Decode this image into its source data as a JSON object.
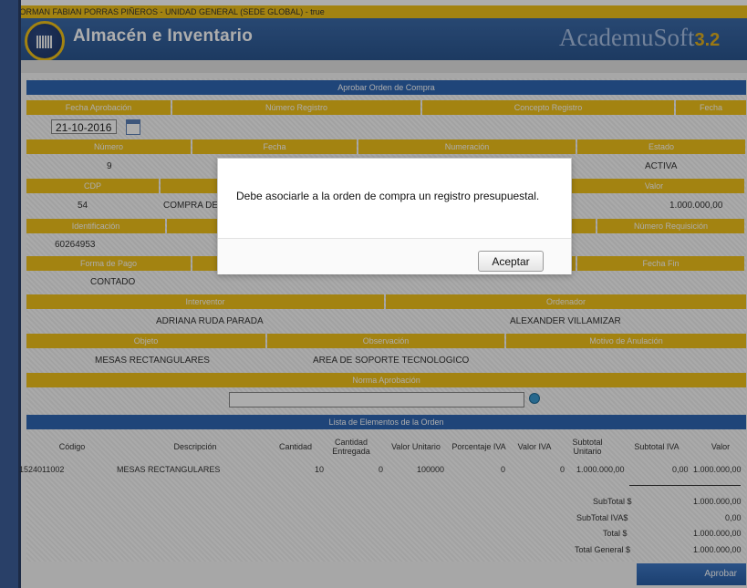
{
  "user_bar": "JORMAN FABIAN PORRAS PIÑEROS - UNIDAD GENERAL (SEDE GLOBAL) - true",
  "app_title": "Almacén e Inventario",
  "brand": {
    "name": "AcademuSoft",
    "version": "3.2"
  },
  "form_title": "Aprobar Orden de Compra",
  "row1": {
    "headers": [
      "Fecha Aprobación",
      "Número Registro",
      "Concepto Registro",
      "Fecha"
    ],
    "date_value": "21-10-2016"
  },
  "row2": {
    "headers": [
      "Número",
      "Fecha",
      "Numeración",
      "Estado"
    ],
    "values": {
      "numero": "9",
      "estado": "ACTIVA"
    }
  },
  "row3": {
    "headers": [
      "CDP",
      "",
      "Valor"
    ],
    "values": {
      "cdp": "54",
      "concepto": "COMPRA DE",
      "valor": "1.000.000,00"
    }
  },
  "row4": {
    "headers": [
      "Identificación",
      "",
      "Número Requisición"
    ],
    "values": {
      "identificacion": "60264953"
    }
  },
  "row5": {
    "headers": [
      "Forma de Pago",
      "",
      "Fecha Fin"
    ],
    "values": {
      "forma_pago": "CONTADO"
    }
  },
  "row6": {
    "headers": [
      "Interventor",
      "Ordenador"
    ],
    "values": {
      "interventor": "ADRIANA RUDA PARADA",
      "ordenador": "ALEXANDER VILLAMIZAR"
    }
  },
  "row7": {
    "headers": [
      "Objeto",
      "Observación",
      "Motivo de Anulación"
    ],
    "values": {
      "objeto": "MESAS RECTANGULARES",
      "observacion": "AREA DE SOPORTE TECNOLOGICO"
    }
  },
  "norma": {
    "header": "Norma Aprobación",
    "value": ""
  },
  "items": {
    "title": "Lista de Elementos de la Orden",
    "columns": [
      "Código",
      "Descripción",
      "Cantidad",
      "Cantidad Entregada",
      "Valor Unitario",
      "Porcentaje IVA",
      "Valor IVA",
      "Subtotal Unitario",
      "Subtotal IVA",
      "Valor"
    ],
    "rows": [
      {
        "codigo": "1524011002",
        "descripcion": "MESAS RECTANGULARES",
        "cantidad": "10",
        "entregada": "0",
        "valor_unitario": "100000",
        "porcentaje_iva": "0",
        "valor_iva": "0",
        "subtotal_unitario": "1.000.000,00",
        "subtotal_iva": "0,00",
        "valor": "1.000.000,00"
      }
    ]
  },
  "totals": [
    {
      "label": "SubTotal $",
      "value": "1.000.000,00"
    },
    {
      "label": "SubTotal IVA$",
      "value": "0,00"
    },
    {
      "label": "Total $",
      "value": "1.000.000,00"
    },
    {
      "label": "Total General $",
      "value": "1.000.000,00"
    }
  ],
  "approve_button": "Aprobar",
  "dialog": {
    "message": "Debe asociarle a la orden de compra un registro presupuestal.",
    "accept": "Aceptar"
  },
  "colors": {
    "header_blue": "#2f66b3",
    "label_yellow": "#f1c21a"
  }
}
